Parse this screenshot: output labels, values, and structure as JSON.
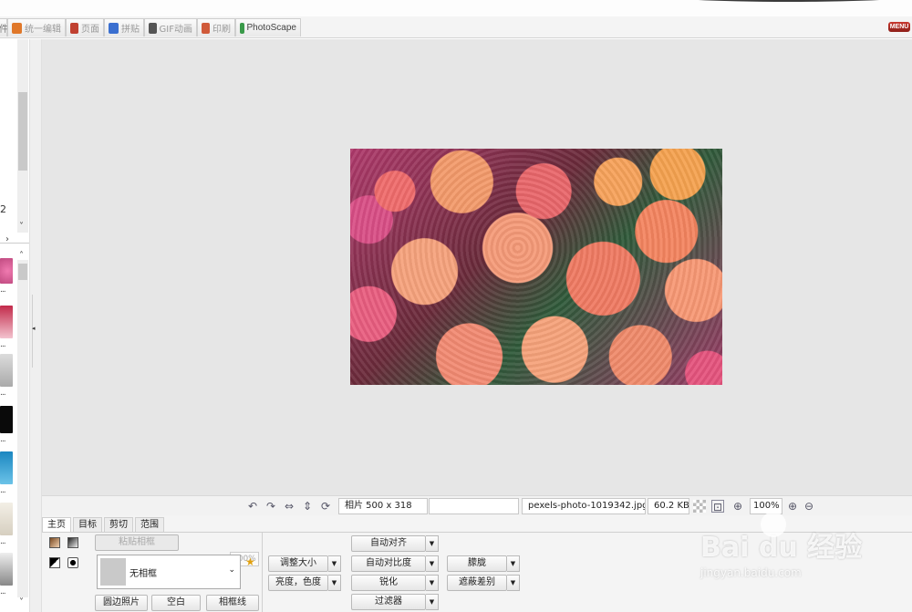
{
  "tabs": [
    {
      "label": "件",
      "icon": "folder-icon",
      "color": "#2a6fc9"
    },
    {
      "label": "统一编辑",
      "icon": "photo-edit-icon",
      "color": "#e0782a"
    },
    {
      "label": "页面",
      "icon": "page-icon",
      "color": "#c04030"
    },
    {
      "label": "拼贴",
      "icon": "collage-icon",
      "color": "#3a6fd0"
    },
    {
      "label": "GIF动画",
      "icon": "gif-icon",
      "color": "#555555"
    },
    {
      "label": "印刷",
      "icon": "print-icon",
      "color": "#d05a3a"
    },
    {
      "label": "PhotoScape",
      "icon": "photoscape-icon",
      "color": "#3a9a4a"
    }
  ],
  "menu_label": "MENU",
  "left_panel": {
    "label_fragment": "2",
    "thumb_dots": "..."
  },
  "status": {
    "photo_size": "相片 500 x 318",
    "empty_field": "",
    "filename": "pexels-photo-1019342.jpg",
    "filesize": "60.2 KB",
    "zoom": "100%"
  },
  "editor": {
    "tabs": [
      "主页",
      "目标",
      "剪切",
      "范围"
    ],
    "active_tab": "主页",
    "paste_frame": "粘贴相框",
    "percent": "100%",
    "frame_selected": "无相框",
    "round_photo": "圆边照片",
    "blank": "空白",
    "frame_line": "相框线",
    "resize": "调整大小",
    "brightness_color": "亮度，色度",
    "auto_level": "自动对齐",
    "auto_contrast": "自动对比度",
    "sharpen": "锐化",
    "filter": "过滤器",
    "backlight": "朦胧",
    "deblemish": "遮蔽差别"
  },
  "watermark": {
    "main": "Bai du 经验",
    "sub": "jingyan.baidu.com"
  }
}
